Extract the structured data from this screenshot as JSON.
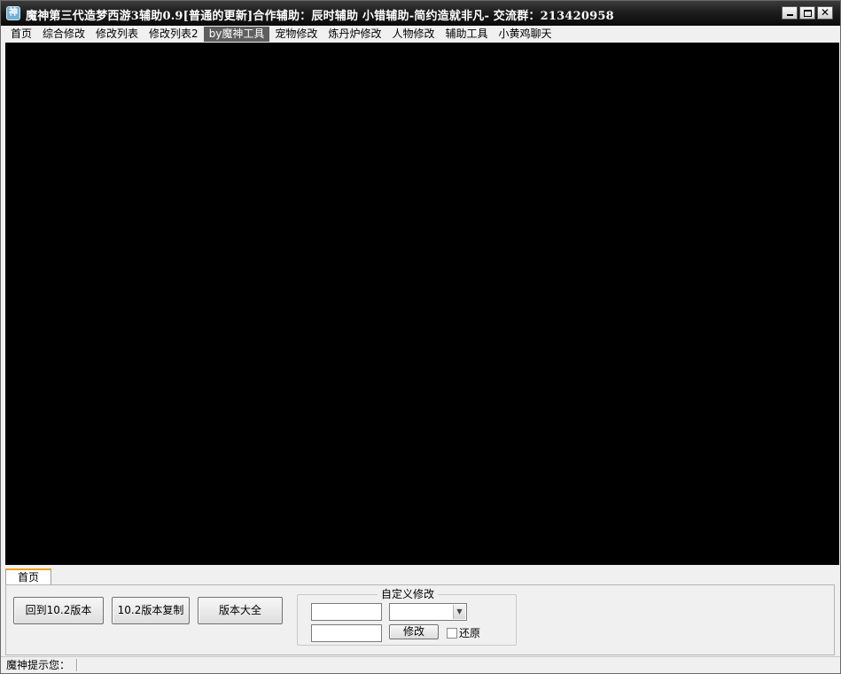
{
  "window": {
    "title": "魔神第三代造梦西游3辅助0.9[普通的更新]合作辅助：辰时辅助  小错辅助-简约造就非凡- 交流群：213420958",
    "icon_glyph": "神"
  },
  "menu": {
    "items": [
      {
        "id": "home",
        "label": "首页"
      },
      {
        "id": "general",
        "label": "综合修改"
      },
      {
        "id": "list1",
        "label": "修改列表"
      },
      {
        "id": "list2",
        "label": "修改列表2"
      },
      {
        "id": "tools",
        "label": "by魔神工具"
      },
      {
        "id": "pet",
        "label": "宠物修改"
      },
      {
        "id": "furnace",
        "label": "炼丹炉修改"
      },
      {
        "id": "character",
        "label": "人物修改"
      },
      {
        "id": "aux",
        "label": "辅助工具"
      },
      {
        "id": "chat",
        "label": "小黄鸡聊天"
      }
    ],
    "active": "tools"
  },
  "bottom": {
    "tab_label": "首页",
    "buttons": {
      "back_v102": "回到10.2版本",
      "copy_v102": "10.2版本复制",
      "all_versions": "版本大全"
    },
    "custom": {
      "legend": "自定义修改",
      "modify_label": "修改",
      "restore_label": "还原",
      "restore_checked": false
    }
  },
  "status": {
    "label": "魔神提示您："
  },
  "icons": {
    "app": "app-logo-icon",
    "minimize": "minimize-icon",
    "maximize": "maximize-icon",
    "close": "close-icon",
    "dropdown": "chevron-down-icon"
  }
}
